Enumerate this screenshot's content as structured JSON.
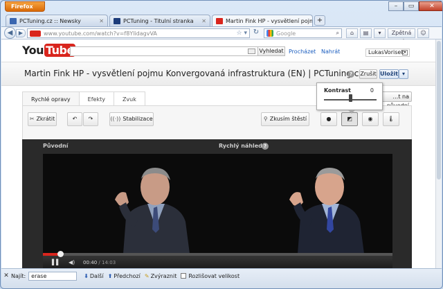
{
  "browser": {
    "app_button": "Firefox",
    "tabs": [
      {
        "label": "PCTuning.cz :: Newsky",
        "active": false
      },
      {
        "label": "PCTuning - Titulní stranka",
        "active": false
      },
      {
        "label": "Martin Fink HP - vysvětlení pojmu Ko...",
        "active": true
      }
    ],
    "new_tab": "+",
    "url_prefix": "www.youtube.com",
    "url_path": "/watch?v=f8YlidagvVA",
    "search_placeholder": "Google",
    "feedback_label": "Zpětná vazba",
    "window_controls": {
      "minimize": "–",
      "maximize": "▭",
      "close": "✕"
    }
  },
  "youtube": {
    "logo_you": "You",
    "logo_tube": "Tube",
    "search_button": "Vyhledat",
    "browse_link": "Procházet",
    "upload_link": "Nahrát",
    "username": "LukasVorisek"
  },
  "video_editor": {
    "title": "Martin Fink HP - vysvětlení pojmu Konvergovaná infrastruktura (EN) | PCTuning.cz",
    "help": "?",
    "cancel_button": "Zrušit",
    "save_button": "Uložit",
    "revert_button": "…t na původní",
    "tabs": [
      "Rychlé opravy",
      "Efekty",
      "Zvuk"
    ],
    "tools": {
      "trim": "Zkrátit",
      "stabilize": "Stabilizace",
      "feeling_lucky": "Zkusím štěstí"
    },
    "contrast_popup": {
      "label": "Kontrast",
      "value": "0",
      "level_fraction": 0.5
    },
    "original_label": "Původní",
    "preview_label": "Rychlý náhled",
    "time_current": "00:40",
    "time_total": "14:03",
    "progress_fraction": 0.05
  },
  "find_bar": {
    "label": "Najít:",
    "query": "erase",
    "next": "Další",
    "prev": "Předchozí",
    "highlight": "Zvýraznit",
    "match_case": "Rozlišovat velikost"
  },
  "colors": {
    "youtube_red": "#d9251d",
    "firefox_orange": "#e07b14",
    "link_blue": "#1a5dbf"
  }
}
